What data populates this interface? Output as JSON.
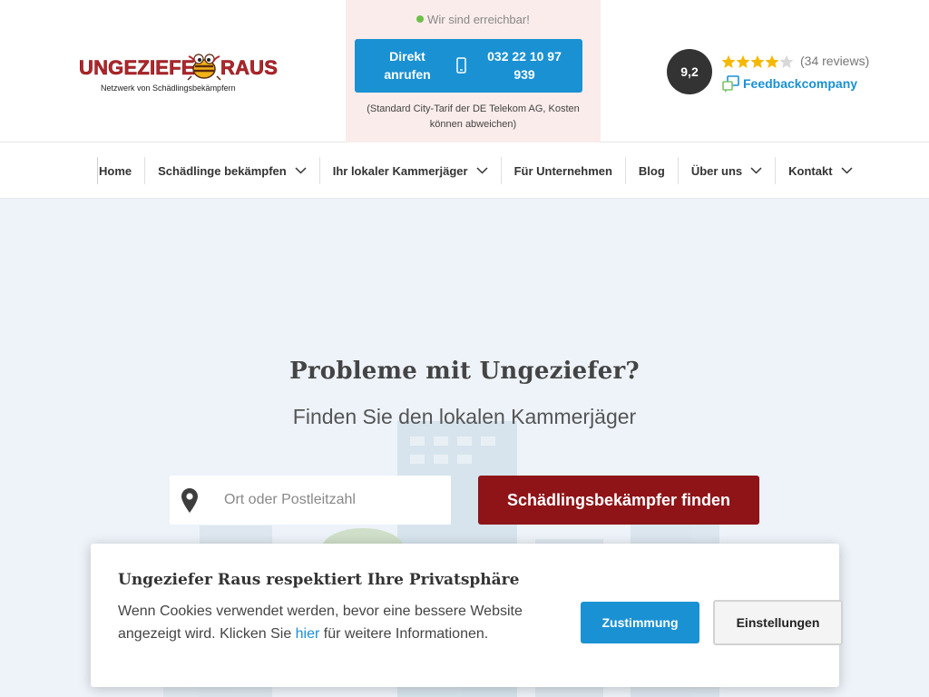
{
  "logo": {
    "word_left": "UNGEZIEFER",
    "word_right": "RAUS",
    "tagline": "Netzwerk von Schädlingsbekämpfern"
  },
  "call": {
    "reachable": "Wir sind erreichbar!",
    "button_label": "Direkt anrufen",
    "phone_number": "032 22 10 97 939",
    "note": "(Standard City-Tarif der DE Telekom AG, Kosten können abweichen)"
  },
  "rating": {
    "score": "9,2",
    "stars": 4.5,
    "reviews": "(34 reviews)",
    "provider": "Feedbackcompany"
  },
  "nav": {
    "items": [
      {
        "label": "Home",
        "dropdown": false
      },
      {
        "label": "Schädlinge bekämpfen",
        "dropdown": true
      },
      {
        "label": "Ihr lokaler Kammerjäger",
        "dropdown": true
      },
      {
        "label": "Für Unternehmen",
        "dropdown": false
      },
      {
        "label": "Blog",
        "dropdown": false
      },
      {
        "label": "Über uns",
        "dropdown": true
      },
      {
        "label": "Kontakt",
        "dropdown": true
      }
    ]
  },
  "hero": {
    "title": "Probleme mit Ungeziefer?",
    "subtitle": "Finden Sie den lokalen Kammerjäger",
    "search_placeholder": "Ort oder Postleitzahl",
    "search_value": "",
    "find_button": "Schädlingsbekämpfer finden"
  },
  "cookie": {
    "title": "Ungeziefer Raus respektiert Ihre Privatsphäre",
    "text_before": "Wenn Cookies verwendet werden, bevor eine bessere Website angezeigt wird. Klicken Sie ",
    "link": "hier",
    "text_after": " für weitere Informationen.",
    "agree_button": "Zustimmung",
    "settings_button": "Einstellungen"
  },
  "colors": {
    "brand_red": "#8e1418",
    "accent_blue": "#1a91d3",
    "star_yellow": "#f5b800",
    "call_box_bg": "#f9ecea",
    "hero_bg": "#edf3f9"
  },
  "icons": {
    "phone": "mobile-phone-icon",
    "pin": "location-pin-icon",
    "chevron": "chevron-down-icon",
    "feedback": "feedbackcompany-logo-icon",
    "status": "online-dot-icon"
  }
}
